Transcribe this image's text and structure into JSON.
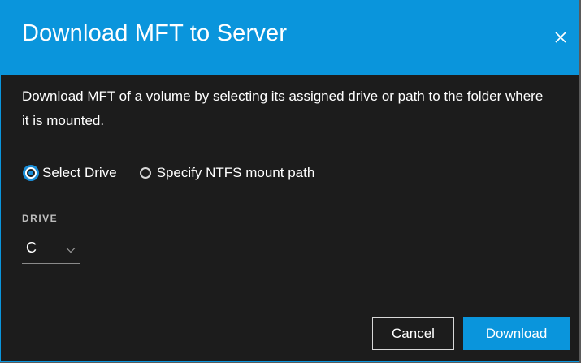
{
  "dialog": {
    "title": "Download MFT to Server",
    "close_icon": "close-icon",
    "description": "Download MFT of a volume by selecting its assigned drive or path to the folder where it is mounted."
  },
  "options": {
    "select_drive": {
      "label": "Select Drive",
      "checked": true
    },
    "ntfs_path": {
      "label": "Specify NTFS mount path",
      "checked": false
    }
  },
  "drive": {
    "label": "DRIVE",
    "value": "C",
    "dropdown_icon": "chevron-down-icon"
  },
  "buttons": {
    "cancel": "Cancel",
    "download": "Download"
  },
  "colors": {
    "accent": "#0a95dc",
    "background": "#1c1c1c"
  }
}
